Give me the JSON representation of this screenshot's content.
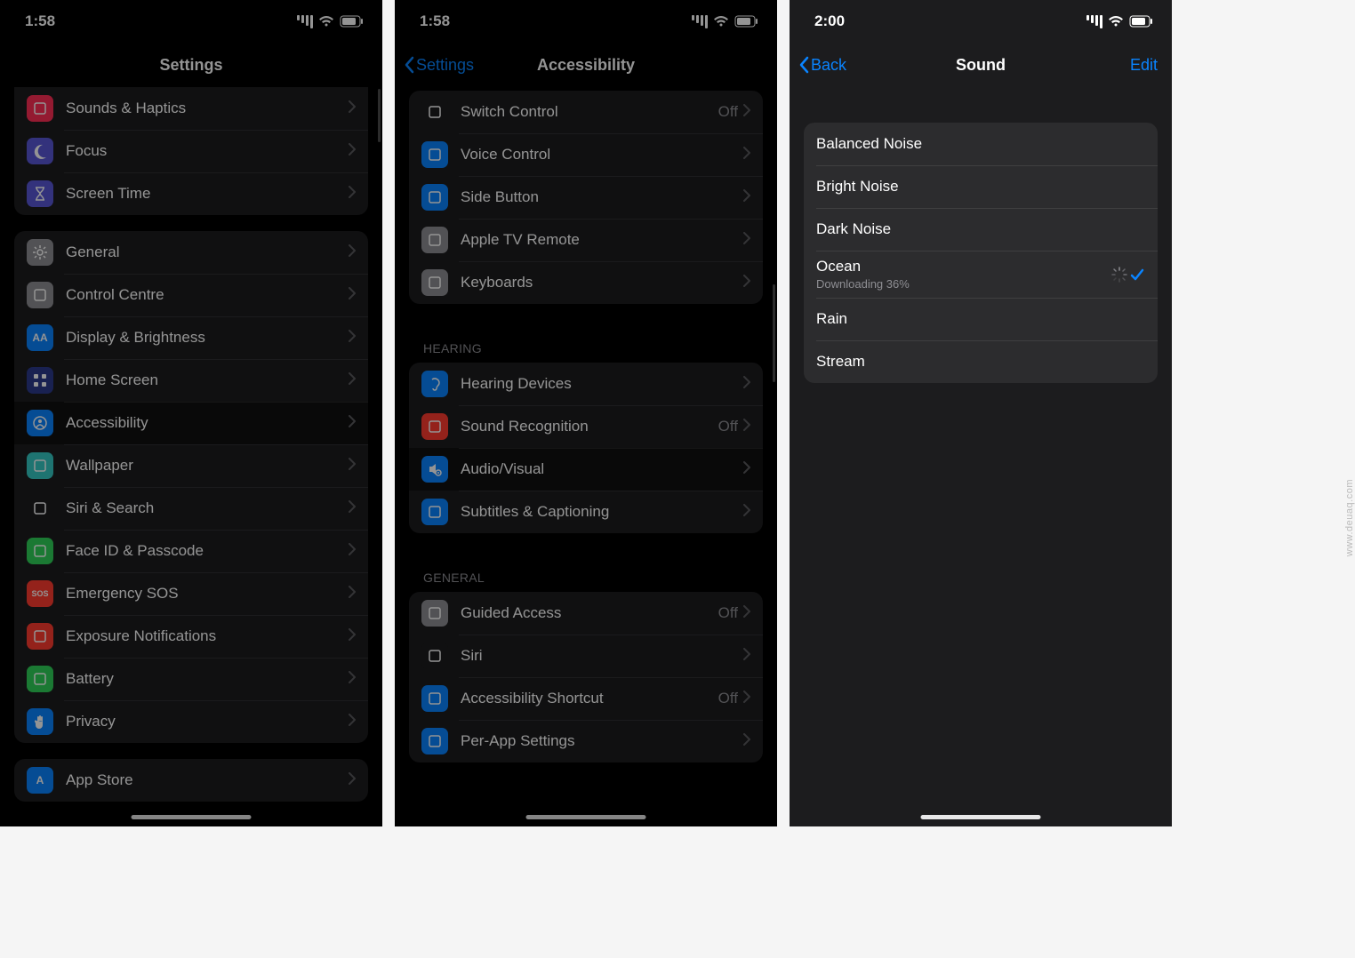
{
  "watermark": "www.deuaq.com",
  "screen1": {
    "time": "1:58",
    "title": "Settings",
    "items_top": [
      {
        "label": "Sounds & Haptics",
        "color": "#ff2d55",
        "icon": "speaker"
      },
      {
        "label": "Focus",
        "color": "#5856d6",
        "icon": "moon"
      },
      {
        "label": "Screen Time",
        "color": "#5856d6",
        "icon": "hourglass"
      }
    ],
    "items_main": [
      {
        "label": "General",
        "color": "#8e8e93",
        "icon": "gear"
      },
      {
        "label": "Control Centre",
        "color": "#8e8e93",
        "icon": "sliders"
      },
      {
        "label": "Display & Brightness",
        "color": "#0a84ff",
        "icon": "AA"
      },
      {
        "label": "Home Screen",
        "color": "#2b3a8c",
        "icon": "grid"
      },
      {
        "label": "Accessibility",
        "color": "#0a84ff",
        "icon": "person",
        "highlight": true
      },
      {
        "label": "Wallpaper",
        "color": "#35c9c3",
        "icon": "flower"
      },
      {
        "label": "Siri & Search",
        "color": "#1c1c1e",
        "icon": "siri"
      },
      {
        "label": "Face ID & Passcode",
        "color": "#30d158",
        "icon": "face"
      },
      {
        "label": "Emergency SOS",
        "color": "#ff3b30",
        "icon": "SOS"
      },
      {
        "label": "Exposure Notifications",
        "color": "#ff3b30",
        "icon": "en"
      },
      {
        "label": "Battery",
        "color": "#30d158",
        "icon": "battery"
      },
      {
        "label": "Privacy",
        "color": "#0a84ff",
        "icon": "hand"
      }
    ],
    "items_bottom": [
      {
        "label": "App Store",
        "color": "#0a84ff",
        "icon": "A"
      }
    ]
  },
  "screen2": {
    "time": "1:58",
    "back": "Settings",
    "title": "Accessibility",
    "items_physical": [
      {
        "label": "Switch Control",
        "value": "Off",
        "color": "#1c1c1e",
        "icon": "switch"
      },
      {
        "label": "Voice Control",
        "color": "#0a84ff",
        "icon": "voice"
      },
      {
        "label": "Side Button",
        "color": "#0a84ff",
        "icon": "side"
      },
      {
        "label": "Apple TV Remote",
        "color": "#8e8e93",
        "icon": "remote"
      },
      {
        "label": "Keyboards",
        "color": "#8e8e93",
        "icon": "kb"
      }
    ],
    "header_hearing": "HEARING",
    "items_hearing": [
      {
        "label": "Hearing Devices",
        "color": "#0a84ff",
        "icon": "ear"
      },
      {
        "label": "Sound Recognition",
        "value": "Off",
        "color": "#ff3b30",
        "icon": "wave"
      },
      {
        "label": "Audio/Visual",
        "color": "#0a84ff",
        "icon": "av",
        "highlight": true
      },
      {
        "label": "Subtitles & Captioning",
        "color": "#0a84ff",
        "icon": "cc"
      }
    ],
    "header_general": "GENERAL",
    "items_general": [
      {
        "label": "Guided Access",
        "value": "Off",
        "color": "#8e8e93",
        "icon": "lock"
      },
      {
        "label": "Siri",
        "color": "#1c1c1e",
        "icon": "siri"
      },
      {
        "label": "Accessibility Shortcut",
        "value": "Off",
        "color": "#0a84ff",
        "icon": "tap"
      },
      {
        "label": "Per-App Settings",
        "color": "#0a84ff",
        "icon": "app"
      }
    ]
  },
  "screen3": {
    "time": "2:00",
    "back": "Back",
    "title": "Sound",
    "edit": "Edit",
    "sounds": [
      {
        "label": "Balanced Noise"
      },
      {
        "label": "Bright Noise"
      },
      {
        "label": "Dark Noise"
      },
      {
        "label": "Ocean",
        "sub": "Downloading 36%",
        "checked": true,
        "spinner": true
      },
      {
        "label": "Rain"
      },
      {
        "label": "Stream"
      }
    ]
  }
}
